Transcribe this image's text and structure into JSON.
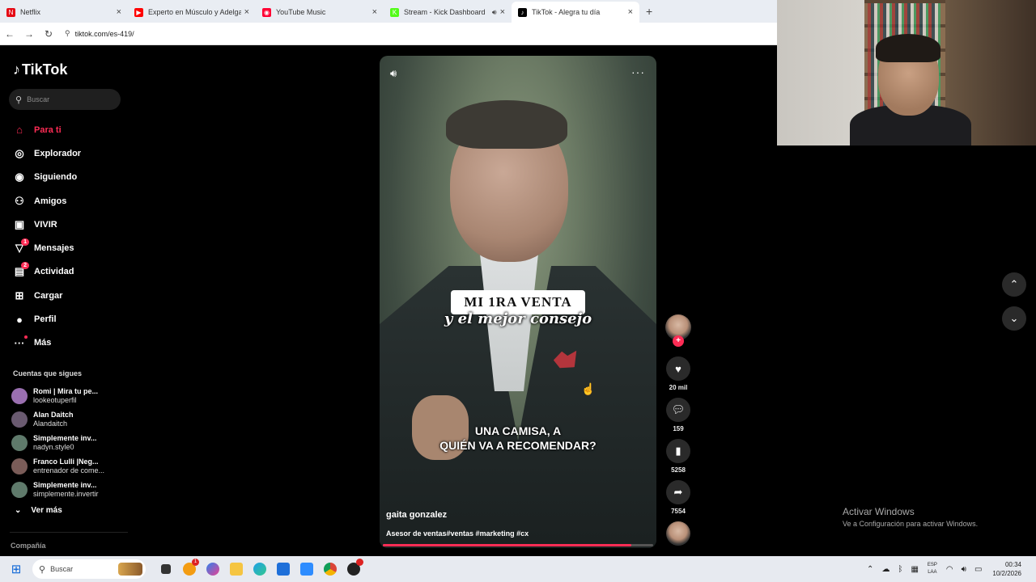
{
  "browser": {
    "tabs": [
      {
        "label": "Netflix",
        "fav_color": "#e50914",
        "fav_text": "N"
      },
      {
        "label": "Experto en Músculo y Adelgaza",
        "fav_color": "#ff0000",
        "fav_text": "▶"
      },
      {
        "label": "YouTube Music",
        "fav_color": "#ff0033",
        "fav_text": "◉"
      },
      {
        "label": "Stream - Kick Dashboard",
        "fav_color": "#53fc18",
        "fav_text": "K"
      },
      {
        "label": "TikTok - Alegra tu día",
        "fav_color": "#000000",
        "fav_text": "♪"
      }
    ],
    "url": "tiktok.com/es-419/"
  },
  "tiktok": {
    "logo": "TikTok",
    "search_placeholder": "Buscar",
    "nav": [
      {
        "label": "Para ti",
        "icon": "home-icon",
        "glyph": "⌂",
        "active": true
      },
      {
        "label": "Explorador",
        "icon": "compass-icon",
        "glyph": "◎"
      },
      {
        "label": "Siguiendo",
        "icon": "following-icon",
        "glyph": "◉"
      },
      {
        "label": "Amigos",
        "icon": "friends-icon",
        "glyph": "⚇"
      },
      {
        "label": "VIVIR",
        "icon": "live-icon",
        "glyph": "▣"
      },
      {
        "label": "Mensajes",
        "icon": "messages-icon",
        "glyph": "▽",
        "badge": "1"
      },
      {
        "label": "Actividad",
        "icon": "activity-icon",
        "glyph": "▤",
        "badge": "2"
      },
      {
        "label": "Cargar",
        "icon": "upload-icon",
        "glyph": "⊞"
      },
      {
        "label": "Perfil",
        "icon": "profile-icon",
        "glyph": "●"
      },
      {
        "label": "Más",
        "icon": "more-icon",
        "glyph": "···",
        "dot": true
      }
    ],
    "following_title": "Cuentas que sigues",
    "following": [
      {
        "name": "Romi | Mira tu pe...",
        "handle": "lookeotuperfil",
        "color": "#9a6fb0"
      },
      {
        "name": "Alan Daitch",
        "handle": "Alandaitch",
        "color": "#6a5a70"
      },
      {
        "name": "Simplemente inv...",
        "handle": "nadyn.style0",
        "color": "#5f7a6b"
      },
      {
        "name": "Franco Lulli |Neg...",
        "handle": "entrenador de come...",
        "color": "#7a5c58"
      },
      {
        "name": "Simplemente inv...",
        "handle": "simplemente.invertir",
        "color": "#5f7a6b"
      }
    ],
    "see_more": "Ver más",
    "company": "Compañía"
  },
  "video": {
    "title_box": "MI 1RA VENTA",
    "title_sub": "y el mejor consejo",
    "caption_line1": "UNA CAMISA, A",
    "caption_line2": "QUIÉN VA A RECOMENDAR?",
    "author": "gaita gonzalez",
    "description": "Asesor de ventas#ventas #marketing #cx",
    "progress": 0.92
  },
  "actions": {
    "likes": "20 mil",
    "comments": "159",
    "saves": "5258",
    "shares": "7554"
  },
  "watermark": {
    "line1": "Activar Windows",
    "line2": "Ve a Configuración para activar Windows."
  },
  "taskbar": {
    "search": "Buscar",
    "lang_line1": "ESP",
    "lang_line2": "LAA",
    "time": "00:34",
    "date": "10/2/2026"
  }
}
